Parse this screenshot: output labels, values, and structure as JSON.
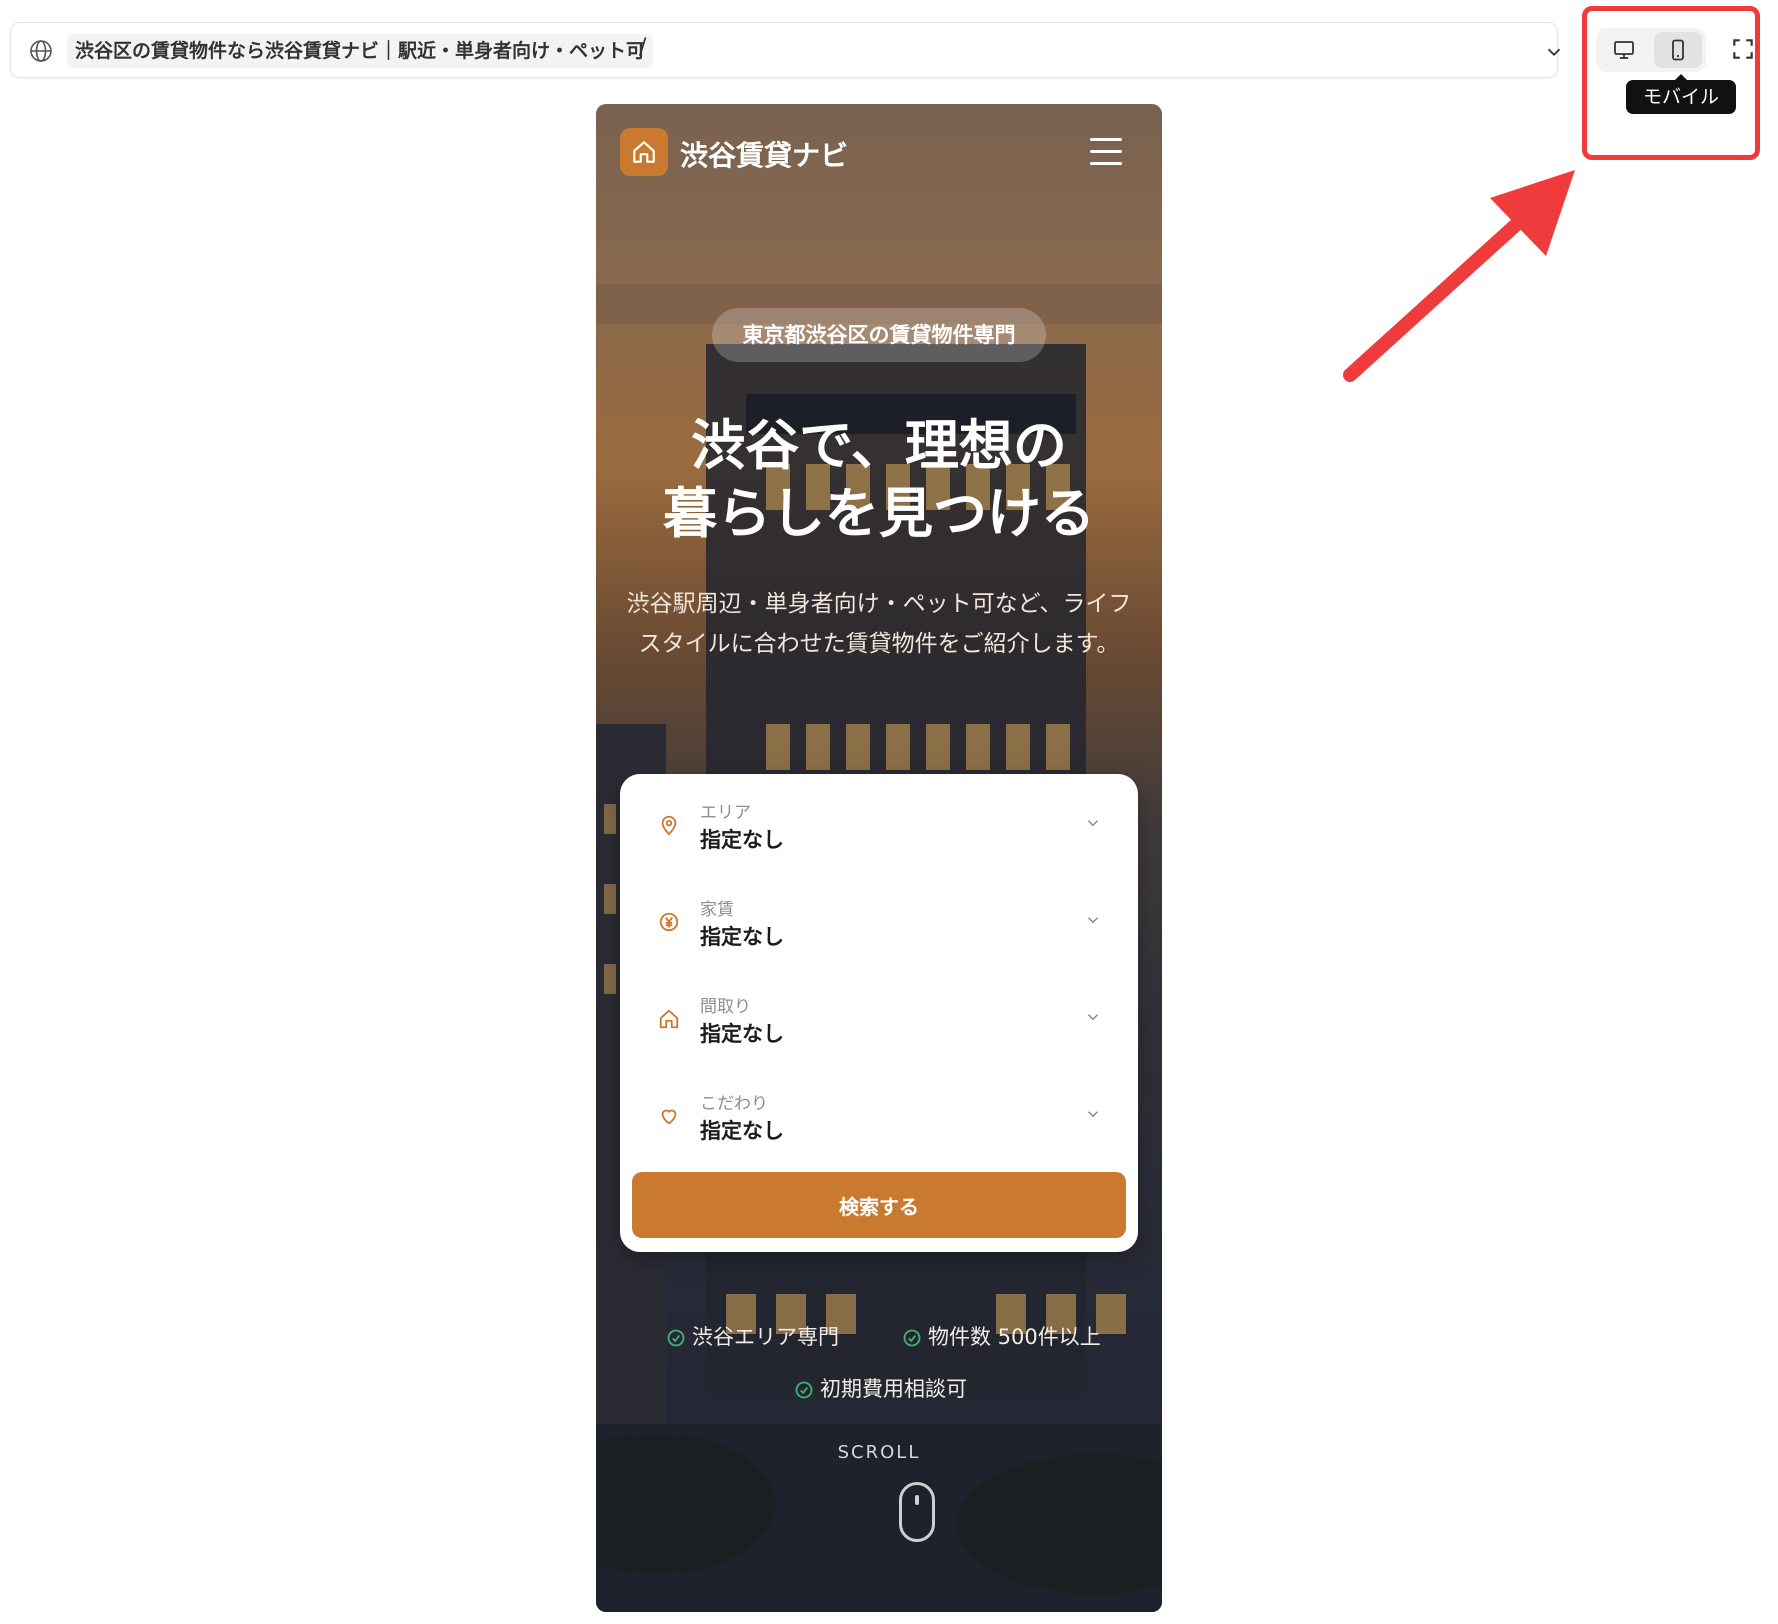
{
  "browser": {
    "page_title": "渋谷区の賃貸物件なら渋谷賃貸ナビ｜駅近・単身者向け・ペット可",
    "path": "/",
    "device_tooltip": "モバイル"
  },
  "site": {
    "brand": "渋谷賃貸ナビ"
  },
  "hero": {
    "badge": "東京都渋谷区の賃貸物件専門",
    "title_line1": "渋谷で、理想の",
    "title_line2": "暮らしを見つける",
    "subtitle": "渋谷駅周辺・単身者向け・ペット可など、ライフスタイルに合わせた賃貸物件をご紹介します。"
  },
  "search": {
    "fields": [
      {
        "label": "エリア",
        "value": "指定なし",
        "icon": "map-pin-icon"
      },
      {
        "label": "家賃",
        "value": "指定なし",
        "icon": "yen-icon"
      },
      {
        "label": "間取り",
        "value": "指定なし",
        "icon": "home-icon"
      },
      {
        "label": "こだわり",
        "value": "指定なし",
        "icon": "heart-icon"
      }
    ],
    "button": "検索する"
  },
  "features": [
    "渋谷エリア専門",
    "物件数 500件以上",
    "初期費用相談可"
  ],
  "scroll_label": "SCROLL",
  "colors": {
    "accent": "#c97a30",
    "annotation": "#ef3b3b",
    "check": "#43b26b"
  }
}
